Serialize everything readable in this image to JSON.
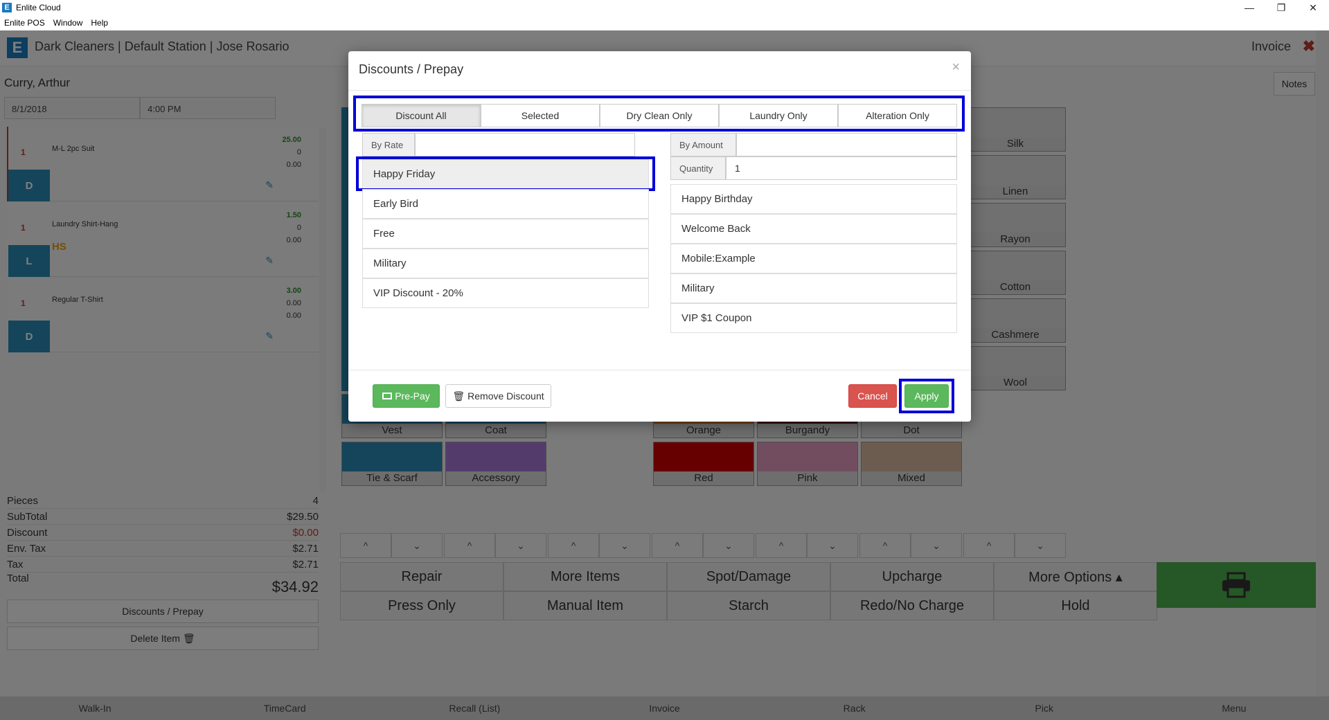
{
  "window": {
    "title": "Enlite Cloud",
    "app_icon": "E",
    "menu": [
      "Enlite POS",
      "Window",
      "Help"
    ],
    "minimize": "—",
    "restore": "❐",
    "close": "✕"
  },
  "header": {
    "logo": "E",
    "title": "Dark Cleaners | Default Station | Jose Rosario",
    "invoice_label": "Invoice",
    "close_icon": "✖"
  },
  "customer": {
    "name": "Curry, Arthur",
    "date": "8/1/2018",
    "time": "4:00 PM"
  },
  "items": [
    {
      "qty": "1",
      "name": "M-L 2pc Suit",
      "price": "25.00",
      "n2": "0",
      "n3": "0.00",
      "category": "D",
      "tag": ""
    },
    {
      "qty": "1",
      "name": "Laundry Shirt-Hang",
      "price": "1.50",
      "n2": "0",
      "n3": "0.00",
      "category": "L",
      "tag": "HS"
    },
    {
      "qty": "1",
      "name": "Regular T-Shirt",
      "price": "3.00",
      "n2": "0.00",
      "n3": "0.00",
      "category": "D",
      "tag": ""
    }
  ],
  "totals": {
    "pieces_label": "Pieces",
    "pieces": "4",
    "subtotal_label": "SubTotal",
    "subtotal": "$29.50",
    "discount_label": "Discount",
    "discount": "$0.00",
    "envtax_label": "Env. Tax",
    "envtax": "$2.71",
    "tax_label": "Tax",
    "tax": "$2.71",
    "total_label": "Total",
    "total": "$34.92"
  },
  "left_buttons": {
    "discounts": "Discounts / Prepay",
    "delete": "Delete Item 🗑"
  },
  "notes_button": "Notes",
  "tiles_right": [
    "Silk",
    "Linen",
    "Rayon",
    "Cotton",
    "Cashmere",
    "Wool"
  ],
  "tiles_row1": [
    "Vest",
    "Coat",
    "Orange",
    "Burgandy",
    "Dot"
  ],
  "tiles_row2": [
    "Tie & Scarf",
    "Accessory",
    "Red",
    "Pink",
    "Mixed"
  ],
  "chevrons": {
    "up": "^",
    "down": "⌄"
  },
  "actions_row1": [
    "Repair",
    "More Items",
    "Spot/Damage",
    "Upcharge",
    "More Options ▴"
  ],
  "actions_row2": [
    "Press Only",
    "Manual Item",
    "Starch",
    "Redo/No Charge",
    "Hold"
  ],
  "bottom_nav": [
    "Walk-In",
    "TimeCard",
    "Recall (List)",
    "Invoice",
    "Rack",
    "Pick",
    "Menu"
  ],
  "modal": {
    "title": "Discounts / Prepay",
    "close": "×",
    "tabs": [
      "Discount All",
      "Selected",
      "Dry Clean Only",
      "Laundry Only",
      "Alteration Only"
    ],
    "by_rate_label": "By Rate",
    "by_rate_value": "",
    "by_amount_label": "By Amount",
    "by_amount_value": "",
    "quantity_label": "Quantity",
    "quantity_value": "1",
    "rate_list": [
      "Happy Friday",
      "Early Bird",
      "Free",
      "Military",
      "VIP Discount - 20%"
    ],
    "amount_list": [
      "Happy Birthday",
      "Welcome Back",
      "Mobile:Example",
      "Military",
      "VIP $1 Coupon"
    ],
    "prepay_label": "Pre-Pay",
    "remove_label": "Remove Discount",
    "cancel_label": "Cancel",
    "apply_label": "Apply"
  },
  "colors": {
    "highlight": "#0000d8",
    "green": "#5cb85c",
    "red": "#d9534f",
    "blue": "#2b8bb5"
  }
}
